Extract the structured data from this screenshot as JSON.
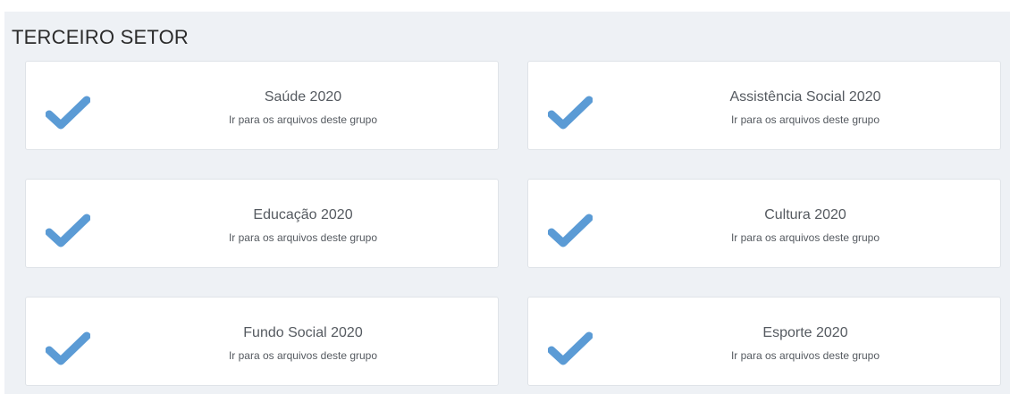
{
  "section": {
    "title": "TERCEIRO SETOR"
  },
  "colors": {
    "check": "#5b9bd5",
    "panel_bg": "#eef1f5",
    "card_bg": "#ffffff",
    "text": "#555a60"
  },
  "cards": [
    {
      "title": "Saúde 2020",
      "subtitle": "Ir para os arquivos deste grupo",
      "icon": "check-icon"
    },
    {
      "title": "Assistência Social 2020",
      "subtitle": "Ir para os arquivos deste grupo",
      "icon": "check-icon"
    },
    {
      "title": "Educação 2020",
      "subtitle": "Ir para os arquivos deste grupo",
      "icon": "check-icon"
    },
    {
      "title": "Cultura 2020",
      "subtitle": "Ir para os arquivos deste grupo",
      "icon": "check-icon"
    },
    {
      "title": "Fundo Social 2020",
      "subtitle": "Ir para os arquivos deste grupo",
      "icon": "check-icon"
    },
    {
      "title": "Esporte 2020",
      "subtitle": "Ir para os arquivos deste grupo",
      "icon": "check-icon"
    }
  ]
}
